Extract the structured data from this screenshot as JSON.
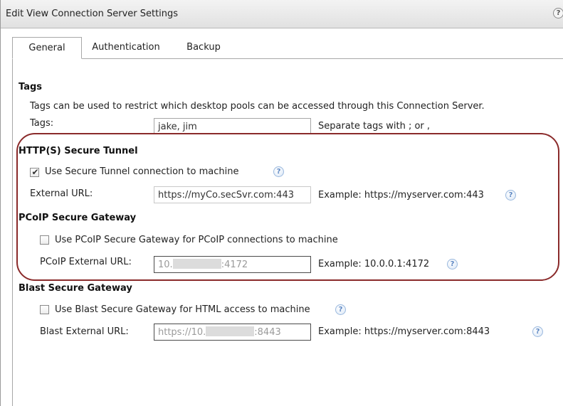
{
  "dialog": {
    "title": "Edit View Connection Server Settings",
    "help_glyph": "?"
  },
  "tabs": [
    {
      "label": "General",
      "active": true
    },
    {
      "label": "Authentication",
      "active": false
    },
    {
      "label": "Backup",
      "active": false
    }
  ],
  "tags_section": {
    "heading": "Tags",
    "description": "Tags can be used to restrict which desktop pools can be accessed through this Connection Server.",
    "field_label": "Tags:",
    "field_value": "jake, jim",
    "hint": "Separate tags with ; or ,"
  },
  "secure_tunnel": {
    "heading": "HTTP(S) Secure Tunnel",
    "checkbox_label": "Use Secure Tunnel connection to machine",
    "checked": true,
    "url_label": "External URL:",
    "url_value": "https://myCo.secSvr.com:443",
    "example": "Example: https://myserver.com:443"
  },
  "pcoip_gateway": {
    "heading": "PCoIP Secure Gateway",
    "checkbox_label": "Use PCoIP Secure Gateway for PCoIP connections to machine",
    "checked": false,
    "url_label": "PCoIP External URL:",
    "url_value_prefix": "10.",
    "url_value_suffix": ":4172",
    "example": "Example: 10.0.0.1:4172"
  },
  "blast_gateway": {
    "heading": "Blast Secure Gateway",
    "checkbox_label": "Use Blast Secure Gateway for HTML access to machine",
    "checked": false,
    "url_label": "Blast External URL:",
    "url_value_prefix": "https://10.",
    "url_value_suffix": ":8443",
    "example": "Example: https://myserver.com:8443"
  },
  "colors": {
    "highlight_frame": "#8a2a2a",
    "help_icon": "#5b86c2"
  },
  "icons": {
    "help": "help-icon",
    "checkmark": "checkmark-icon"
  }
}
